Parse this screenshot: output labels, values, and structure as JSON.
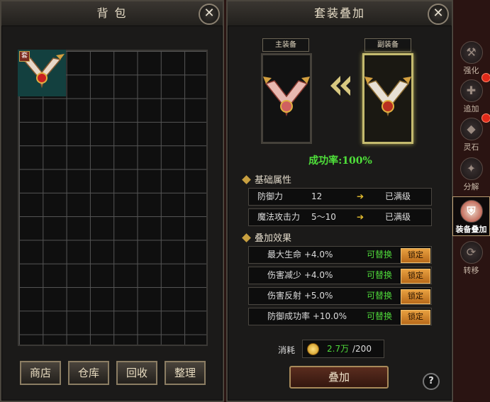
{
  "bag": {
    "title": "背 包",
    "close_icon": "✕",
    "item_tag": "套",
    "buttons": [
      "商店",
      "仓库",
      "回收",
      "整理"
    ]
  },
  "set_panel": {
    "title": "套装叠加",
    "close_icon": "✕",
    "main_equip_label": "主装备",
    "sub_equip_label": "副装备",
    "success_rate": "成功率:100%",
    "basic_section": "基础属性",
    "basic_rows": [
      {
        "name": "防御力",
        "value": "12",
        "status": "已满级"
      },
      {
        "name": "魔法攻击力",
        "value": "5～10",
        "status": "已满级"
      }
    ],
    "effect_section": "叠加效果",
    "effect_rows": [
      {
        "name": "最大生命 +4.0%",
        "state": "可替换",
        "lock": "锁定"
      },
      {
        "name": "伤害减少 +4.0%",
        "state": "可替换",
        "lock": "锁定"
      },
      {
        "name": "伤害反射 +5.0%",
        "state": "可替换",
        "lock": "锁定"
      },
      {
        "name": "防御成功率 +10.0%",
        "state": "可替换",
        "lock": "锁定"
      }
    ],
    "cost_label": "消耗",
    "cost_have": "2.7万",
    "cost_need": "/200",
    "stack_button": "叠加",
    "help": "?"
  },
  "side_tabs": [
    {
      "label": "强化",
      "icon": "hammer-icon"
    },
    {
      "label": "追加",
      "icon": "plus-rune-icon"
    },
    {
      "label": "灵石",
      "icon": "gem-icon"
    },
    {
      "label": "分解",
      "icon": "decompose-icon"
    },
    {
      "label": "装备叠加",
      "icon": "armor-icon"
    },
    {
      "label": "转移",
      "icon": "transfer-icon"
    }
  ],
  "colors": {
    "success_green": "#4fe03a",
    "lock_orange": "#d88a30",
    "arrow_yellow": "#e8c030"
  }
}
